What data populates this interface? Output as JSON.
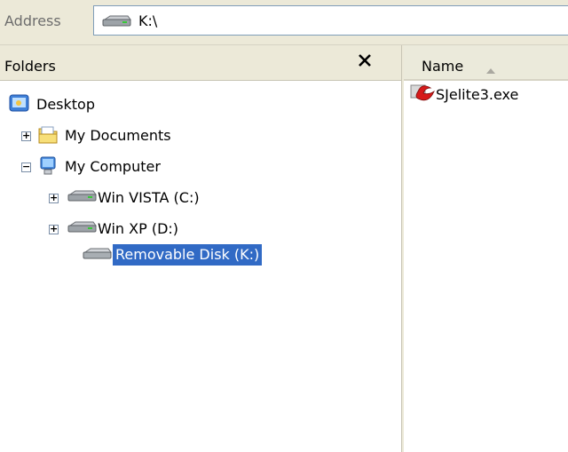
{
  "address": {
    "label": "Address",
    "value": "K:\\"
  },
  "folders": {
    "title": "Folders",
    "close_label": "✕",
    "tree": [
      {
        "label": "Desktop",
        "icon": "desktop-icon",
        "expander": ""
      },
      {
        "label": "My Documents",
        "icon": "folder-icon",
        "expander": "+"
      },
      {
        "label": "My Computer",
        "icon": "computer-icon",
        "expander": "−"
      },
      {
        "label": "Win VISTA (C:)",
        "icon": "drive-icon",
        "expander": "+"
      },
      {
        "label": "Win XP (D:)",
        "icon": "drive-icon",
        "expander": "+"
      },
      {
        "label": "Removable Disk (K:)",
        "icon": "removable-drive-icon",
        "expander": "",
        "selected": true
      }
    ]
  },
  "files": {
    "column_name": "Name",
    "items": [
      {
        "label": "SJelite3.exe",
        "icon": "exe-icon"
      }
    ]
  },
  "colors": {
    "selection": "#316ac5",
    "chrome": "#ece9d8"
  }
}
